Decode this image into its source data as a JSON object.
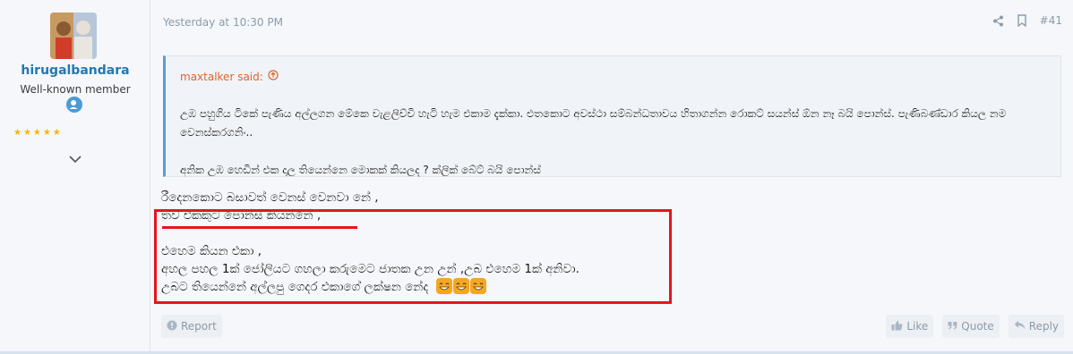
{
  "user": {
    "name": "hirugalbandara",
    "title": "Well-known member",
    "stars": "★★★★★"
  },
  "post": {
    "timestamp": "Yesterday at 10:30 PM",
    "number": "#41",
    "quote": {
      "author_label": "maxtalker said:",
      "paragraph1": "උඹ පහුගිය ටිකේ පැණිය අල්ලගන මේකෙ වැළලිච්චි හැටි හැම එකාම දැක්කා. එතකොට අවස්ථා සම්බන්ධතාවය හිතාගන්න රොකට් සයන්ස් ඕන නෑ බයි පොන්ස්. පැණිබණ්ඩාර කියල නම වෙනස්කරගනිං..",
      "paragraph2": "අනික උඹ හෙඩින් එක දාල තියෙන්නෙ මොකක් කියලද ? ක්ලික් බේට් බයි පොන්ස්"
    },
    "body": {
      "line1": "රීදෙනකොට බසාවත් වෙනස් වෙනවා නේ ,",
      "line2": "තව එකකුට පොන්ස් කියන්නේ ,",
      "line3": "එහෙම කියන එකා ,",
      "line4": "අහල පහල 1ක් ජෝලියට ගහලා කරුමෙට ජාතක උන උන් ,උබ එහෙම 1ක් අනිවා.",
      "line5": "උබට තියෙන්නේ අල්ලපු ගෙදර එකාගේ ලක්ෂන නේද"
    }
  },
  "footer": {
    "report": "Report",
    "like": "Like",
    "quote": "Quote",
    "reply": "Reply"
  },
  "colors": {
    "link": "#2577b1",
    "quote_author": "#e0632a",
    "highlight": "#e4161d"
  }
}
